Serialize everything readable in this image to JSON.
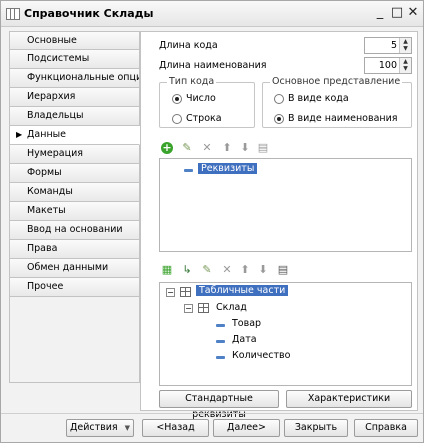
{
  "window": {
    "title": "Справочник Склады"
  },
  "sidebar": {
    "items": [
      {
        "label": "Основные"
      },
      {
        "label": "Подсистемы"
      },
      {
        "label": "Функциональные опции"
      },
      {
        "label": "Иерархия"
      },
      {
        "label": "Владельцы"
      },
      {
        "label": "Данные",
        "active": true
      },
      {
        "label": "Нумерация"
      },
      {
        "label": "Формы"
      },
      {
        "label": "Команды"
      },
      {
        "label": "Макеты"
      },
      {
        "label": "Ввод на основании"
      },
      {
        "label": "Права"
      },
      {
        "label": "Обмен данными"
      },
      {
        "label": "Прочее"
      }
    ]
  },
  "data_tab": {
    "code_length_label": "Длина кода",
    "code_length_value": "5",
    "name_length_label": "Длина наименования",
    "name_length_value": "100",
    "code_type": {
      "caption": "Тип кода",
      "options": [
        "Число",
        "Строка"
      ],
      "selected": "Число"
    },
    "main_presentation": {
      "caption": "Основное представление",
      "options": [
        "В виде кода",
        "В виде наименования"
      ],
      "selected": "В виде наименования"
    },
    "attributes_tree": {
      "items": [
        {
          "label": "Реквизиты",
          "selected": true
        }
      ]
    },
    "tabular_tree": {
      "root": "Табличные части",
      "table": "Склад",
      "fields": [
        "Товар",
        "Дата",
        "Количество"
      ]
    },
    "standard_attributes_button": "Стандартные реквизиты",
    "characteristics_button": "Характеристики"
  },
  "footer": {
    "actions": "Действия",
    "back": "<Назад",
    "next": "Далее>",
    "close": "Закрыть",
    "help": "Справка"
  },
  "colors": {
    "selection": "#3f6fbf",
    "add_green": "#3aa32b",
    "field_icon": "#4f81c7"
  }
}
